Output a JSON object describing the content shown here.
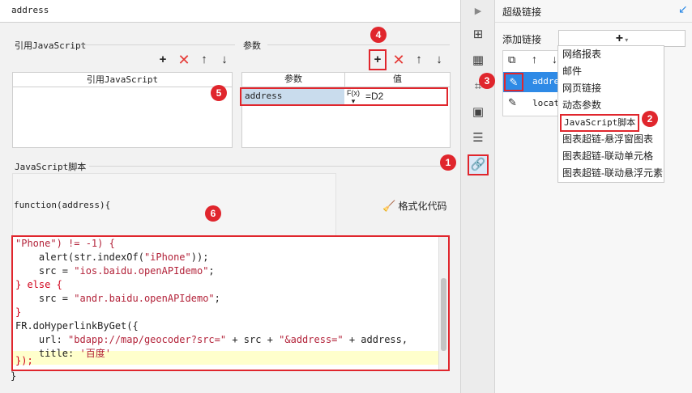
{
  "header": {
    "title": "address"
  },
  "js_ref": {
    "section_label": "引用JavaScript",
    "column_header": "引用JavaScript"
  },
  "params": {
    "section_label": "参数",
    "columns": [
      "参数",
      "值"
    ],
    "rows": [
      {
        "name": "address",
        "formula_icon": "F(x)",
        "value": "=D2"
      }
    ]
  },
  "toolbar": {
    "add": "+",
    "delete": "✕",
    "up": "↑",
    "down": "↓"
  },
  "script": {
    "section_label": "JavaScript脚本",
    "function_header": "function(address){",
    "format_label": "格式化代码",
    "lines": [
      "\"Phone\") != -1) {",
      "    alert(str.indexOf(\"iPhone\"));",
      "    src = \"ios.baidu.openAPIdemo\";",
      "} else {",
      "    src = \"andr.baidu.openAPIdemo\";",
      "}",
      "FR.doHyperlinkByGet({",
      "    url: \"bdapp://map/geocoder?src=\" + src + \"&address=\" + address,",
      "    title: '百度'",
      "});"
    ],
    "closing": "}"
  },
  "side_panel": {
    "title": "超级链接",
    "add_link_label": "添加链接",
    "add_button": "+",
    "links": [
      "address",
      "location"
    ],
    "menu_items": [
      "网络报表",
      "邮件",
      "网页链接",
      "动态参数",
      "JavaScript脚本",
      "图表超链-悬浮窗图表",
      "图表超链-联动单元格",
      "图表超链-联动悬浮元素"
    ]
  },
  "badges": [
    "1",
    "2",
    "3",
    "4",
    "5",
    "6"
  ],
  "colors": {
    "accent_red": "#e0262d",
    "selection_blue": "#2e8ae6",
    "highlight_yellow": "#ffffcc"
  }
}
